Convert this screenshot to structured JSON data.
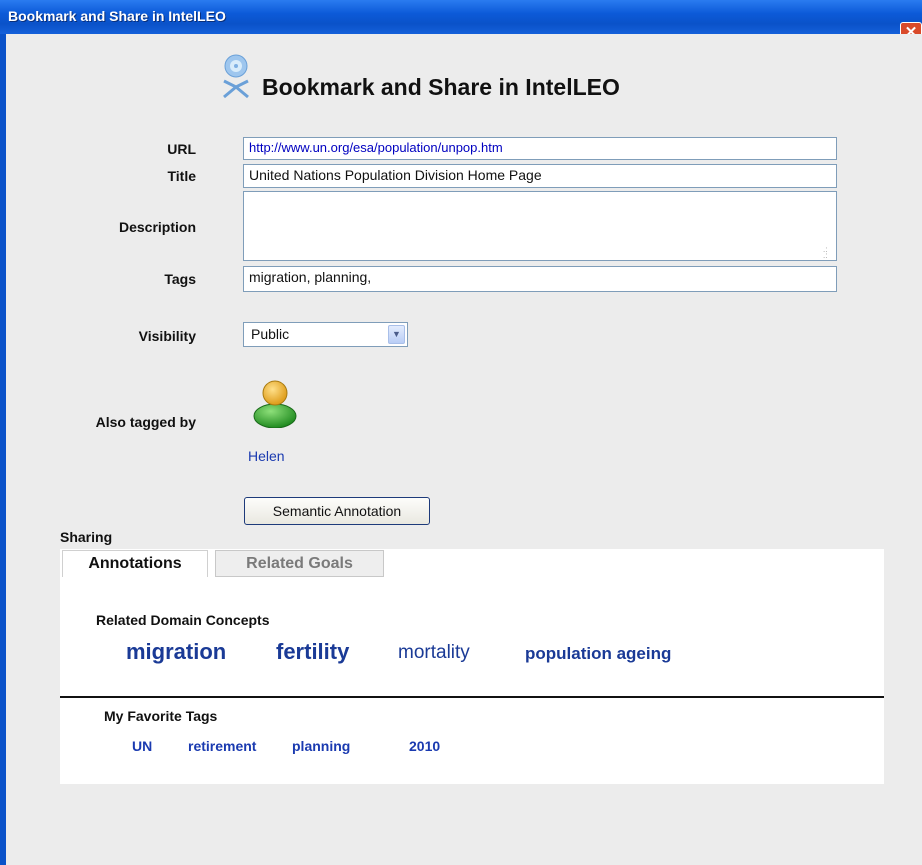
{
  "window": {
    "title": "Bookmark and Share in IntelLEO",
    "close_glyph": "✕"
  },
  "header": {
    "title": "Bookmark and Share in IntelLEO",
    "icon": "intelleo-logo-icon"
  },
  "form": {
    "url_label": "URL",
    "url_value": "http://www.un.org/esa/population/unpop.htm",
    "title_label": "Title",
    "title_value": "United Nations Population Division Home Page",
    "description_label": "Description",
    "description_value": "",
    "tags_label": "Tags",
    "tags_value": "migration, planning,",
    "visibility_label": "Visibility",
    "visibility_value": "Public",
    "also_tagged_label": "Also tagged by",
    "also_tagged_users": [
      "Helen"
    ],
    "semantic_button": "Semantic Annotation"
  },
  "sharing": {
    "label": "Sharing",
    "tabs": [
      "Annotations",
      "Related Goals"
    ],
    "active_tab": "Annotations",
    "related_concepts_title": "Related Domain Concepts",
    "concepts": [
      "migration",
      "fertility",
      "mortality",
      "population ageing"
    ],
    "favorite_tags_title": "My Favorite Tags",
    "favorite_tags": [
      "UN",
      "retirement",
      "planning",
      "2010"
    ]
  },
  "colors": {
    "titlebar": "#0a52c9",
    "link": "#1a3ab0",
    "concept": "#1a3a96"
  }
}
